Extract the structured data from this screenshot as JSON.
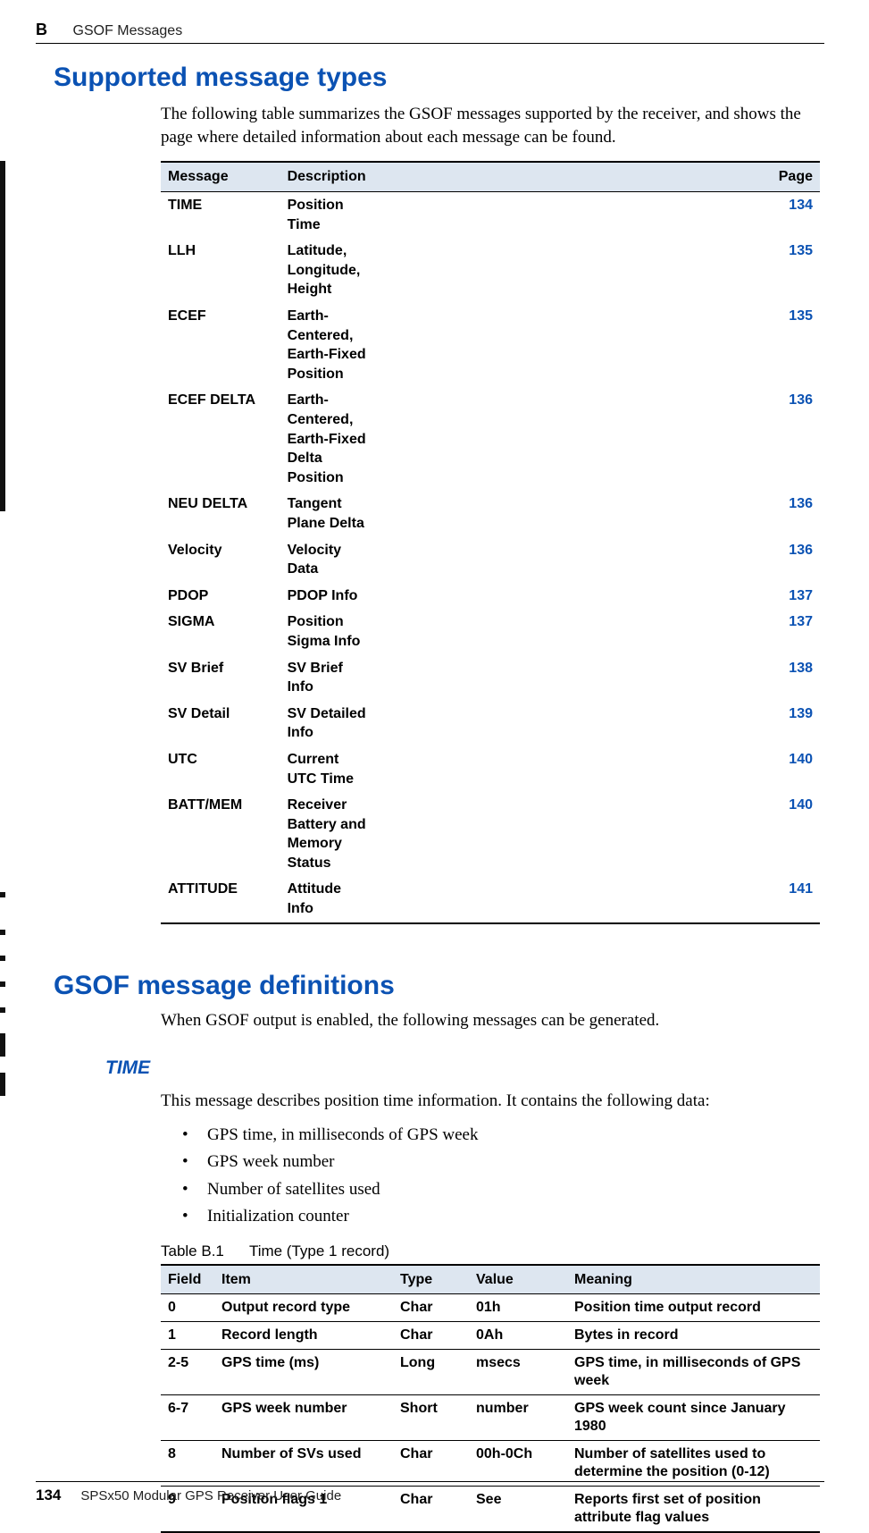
{
  "header": {
    "section_letter": "B",
    "section_title": "GSOF Messages"
  },
  "headings": {
    "h1_supported": "Supported message types",
    "h1_defs": "GSOF message definitions",
    "h3_time": "TIME"
  },
  "paragraphs": {
    "supported_intro": "The following table summarizes the GSOF messages supported by the receiver, and shows the page where detailed information about each message can be found.",
    "defs_intro": "When GSOF output is enabled, the following messages can be generated.",
    "time_intro": "This message describes position time information. It contains the following data:"
  },
  "bullets_time": [
    "GPS time, in milliseconds of GPS week",
    "GPS week number",
    "Number of satellites used",
    "Initialization counter"
  ],
  "table_summary": {
    "head": {
      "message": "Message",
      "description": "Description",
      "page": "Page"
    },
    "rows": [
      {
        "message": "TIME",
        "description": "Position Time",
        "page": "134"
      },
      {
        "message": "LLH",
        "description": "Latitude, Longitude, Height",
        "page": "135"
      },
      {
        "message": "ECEF",
        "description": "Earth-Centered, Earth-Fixed Position",
        "page": "135"
      },
      {
        "message": "ECEF DELTA",
        "description": "Earth-Centered, Earth-Fixed Delta Position",
        "page": "136"
      },
      {
        "message": "NEU DELTA",
        "description": "Tangent Plane Delta",
        "page": "136"
      },
      {
        "message": "Velocity",
        "description": "Velocity Data",
        "page": "136"
      },
      {
        "message": "PDOP",
        "description": "PDOP Info",
        "page": "137"
      },
      {
        "message": "SIGMA",
        "description": "Position Sigma Info",
        "page": "137"
      },
      {
        "message": "SV Brief",
        "description": "SV Brief Info",
        "page": "138"
      },
      {
        "message": "SV Detail",
        "description": "SV Detailed Info",
        "page": "139"
      },
      {
        "message": "UTC",
        "description": "Current UTC Time",
        "page": "140"
      },
      {
        "message": "BATT/MEM",
        "description": "Receiver Battery and Memory Status",
        "page": "140"
      },
      {
        "message": "ATTITUDE",
        "description": "Attitude Info",
        "page": "141"
      }
    ]
  },
  "table_detail": {
    "caption_label": "Table B.1",
    "caption_title": "Time (Type 1 record)",
    "head": {
      "field": "Field",
      "item": "Item",
      "type": "Type",
      "value": "Value",
      "meaning": "Meaning"
    },
    "rows": [
      {
        "field": "0",
        "item": "Output record type",
        "type": "Char",
        "value": "01h",
        "meaning": "Position time output record"
      },
      {
        "field": "1",
        "item": "Record length",
        "type": "Char",
        "value": "0Ah",
        "meaning": "Bytes in record"
      },
      {
        "field": "2-5",
        "item": "GPS time (ms)",
        "type": "Long",
        "value": "msecs",
        "meaning": "GPS time, in milliseconds of GPS week"
      },
      {
        "field": "6-7",
        "item": "GPS week number",
        "type": "Short",
        "value": "number",
        "meaning": "GPS week count since January 1980"
      },
      {
        "field": "8",
        "item": "Number of SVs used",
        "type": "Char",
        "value": "00h-0Ch",
        "meaning": "Number of satellites used to determine the position (0-12)"
      },
      {
        "field": "9",
        "item": "Position flags 1",
        "type": "Char",
        "value": "See",
        "meaning": "Reports first set of position attribute flag values"
      }
    ]
  },
  "footer": {
    "page_number": "134",
    "book_title": "SPSx50 Modular GPS Receiver User Guide"
  }
}
